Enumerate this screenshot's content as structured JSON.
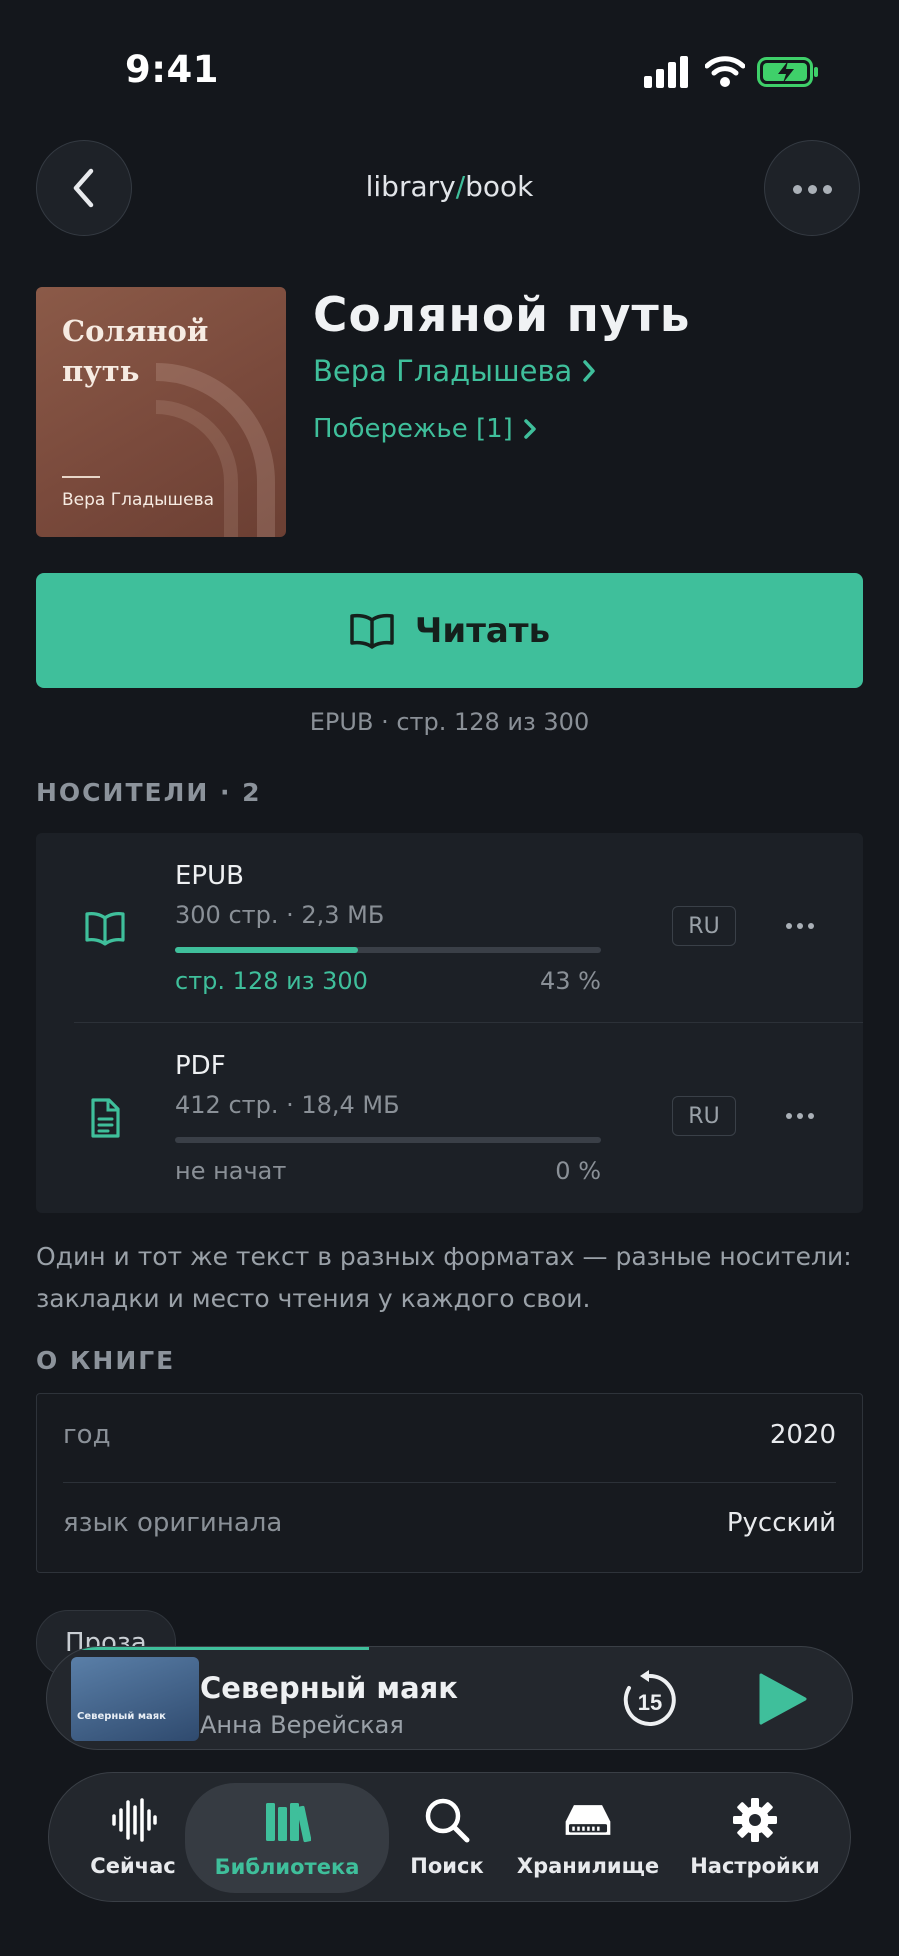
{
  "status": {
    "time": "9:41"
  },
  "header": {
    "path_left": "library",
    "path_sep": "/",
    "path_right": "book"
  },
  "book": {
    "cover_title": "Соляной путь",
    "cover_author": "Вера Гладышева",
    "title": "Соляной путь",
    "author": "Вера Гладышева",
    "series": "Побережье [1]"
  },
  "read_button": {
    "label": "Читать",
    "meta": "EPUB · стр. 128 из 300"
  },
  "carriers": {
    "heading": "НОСИТЕЛИ · 2",
    "items": [
      {
        "format": "EPUB",
        "meta": "300 стр. · 2,3 МБ",
        "progress_text": "стр. 128 из 300",
        "percent_text": "43 %",
        "progress": 0.43,
        "lang": "RU",
        "icon": "book-open-icon"
      },
      {
        "format": "PDF",
        "meta": "412 стр. · 18,4 МБ",
        "progress_text": "не начат",
        "percent_text": "0 %",
        "progress": 0,
        "lang": "RU",
        "icon": "document-icon"
      }
    ],
    "note": "Один и тот же текст в разных форматах — разные носители: закладки и место чтения у каждого свои."
  },
  "about": {
    "heading": "О КНИГЕ",
    "rows": [
      {
        "key": "год",
        "value": "2020"
      },
      {
        "key": "язык оригинала",
        "value": "Русский"
      }
    ],
    "genre_chip": "Проза"
  },
  "player": {
    "title": "Северный маяк",
    "artist": "Анна Верейская",
    "cover_title": "Северный маяк",
    "skip_seconds": "15",
    "progress": 0.4
  },
  "tabs": [
    {
      "label": "Сейчас",
      "icon": "waveform-icon",
      "active": false
    },
    {
      "label": "Библиотека",
      "icon": "library-books-icon",
      "active": true
    },
    {
      "label": "Поиск",
      "icon": "search-icon",
      "active": false
    },
    {
      "label": "Хранилище",
      "icon": "storage-drive-icon",
      "active": false
    },
    {
      "label": "Настройки",
      "icon": "gear-icon",
      "active": false
    }
  ],
  "colors": {
    "accent": "#3fbf9b",
    "background": "#14171c",
    "surface": "#1c2026"
  }
}
